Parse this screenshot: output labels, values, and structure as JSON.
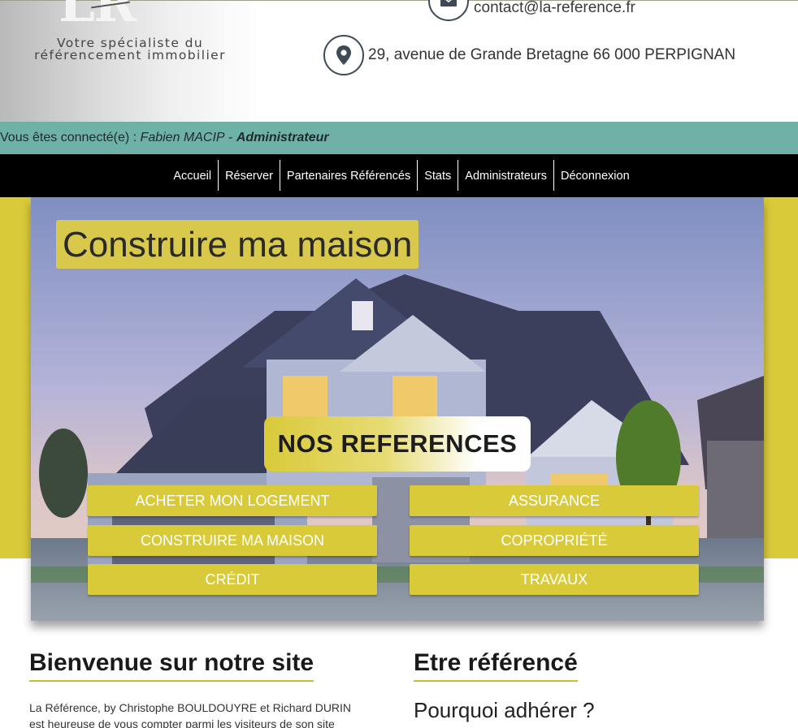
{
  "header": {
    "logo_initials": "LR",
    "tagline_line1": "Votre spécialiste du",
    "tagline_line2": "référencement immobilier",
    "email": "contact@la-reference.fr",
    "email_icon": "envelope-icon",
    "address": "29, avenue de Grande Bretagne  66 000 PERPIGNAN",
    "address_icon": "map-pin-icon"
  },
  "connected": {
    "prefix": "Vous êtes connecté(e) : ",
    "user": "Fabien MACIP",
    "separator": " - ",
    "role": "Administrateur"
  },
  "nav": {
    "items": [
      {
        "label": "Accueil"
      },
      {
        "label": "Réserver"
      },
      {
        "label": "Partenaires Référencés"
      },
      {
        "label": "Stats"
      },
      {
        "label": "Administrateurs"
      },
      {
        "label": "Déconnexion"
      }
    ]
  },
  "hero": {
    "title": "Construire ma maison",
    "refs_title": "NOS REFERENCES",
    "buttons": [
      {
        "label": "ACHETER MON LOGEMENT"
      },
      {
        "label": "ASSURANCE"
      },
      {
        "label": "CONSTRUIRE MA MAISON"
      },
      {
        "label": "COPROPRIÉTÉ"
      },
      {
        "label": "CRÉDIT"
      },
      {
        "label": "TRAVAUX"
      }
    ]
  },
  "content": {
    "welcome_title": "Bienvenue sur notre site",
    "welcome_text_line1": "La Référence, by Christophe BOULDOUYRE et Richard DURIN",
    "welcome_text_line2": "est heureuse de vous compter parmi les visiteurs de son site",
    "refer_title": "Etre référencé",
    "refer_subtitle": "Pourquoi adhérer ?"
  },
  "colors": {
    "accent_yellow": "#d9ca3a",
    "teal_bar": "#6fb1a7",
    "nav_black": "#000000"
  }
}
